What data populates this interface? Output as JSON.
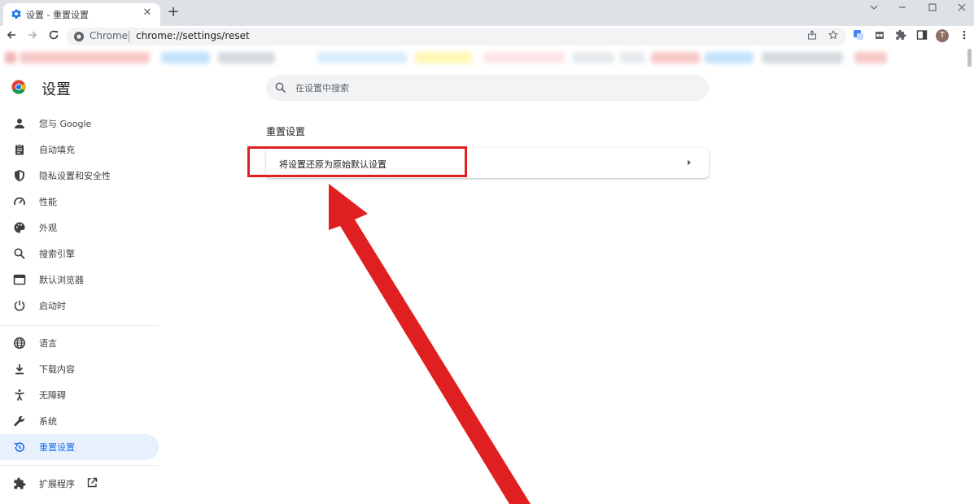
{
  "browser": {
    "tab_title": "设置 - 重置设置",
    "new_tab_symbol": "+",
    "close_symbol": "✕",
    "omnibox_chip": "Chrome",
    "url": "chrome://settings/reset",
    "avatar_letter": "T"
  },
  "settings": {
    "title": "设置",
    "search_placeholder": "在设置中搜索",
    "nav": [
      {
        "label": "您与 Google",
        "icon": "person-icon"
      },
      {
        "label": "自动填充",
        "icon": "clipboard-icon"
      },
      {
        "label": "隐私设置和安全性",
        "icon": "shield-icon"
      },
      {
        "label": "性能",
        "icon": "speedometer-icon"
      },
      {
        "label": "外观",
        "icon": "palette-icon"
      },
      {
        "label": "搜索引擎",
        "icon": "search-icon"
      },
      {
        "label": "默认浏览器",
        "icon": "browser-window-icon"
      },
      {
        "label": "启动时",
        "icon": "power-icon"
      },
      {
        "label": "语言",
        "icon": "globe-icon"
      },
      {
        "label": "下载内容",
        "icon": "download-icon"
      },
      {
        "label": "无障碍",
        "icon": "accessibility-icon"
      },
      {
        "label": "系统",
        "icon": "wrench-icon"
      },
      {
        "label": "重置设置",
        "icon": "restore-icon",
        "active": true
      },
      {
        "label": "扩展程序",
        "icon": "puzzle-icon"
      }
    ],
    "section_title": "重置设置",
    "reset_row_label": "将设置还原为原始默认设置"
  },
  "colors": {
    "accent": "#1a73e8",
    "active_bg": "#e8f0fe",
    "annotation": "#e02020"
  }
}
